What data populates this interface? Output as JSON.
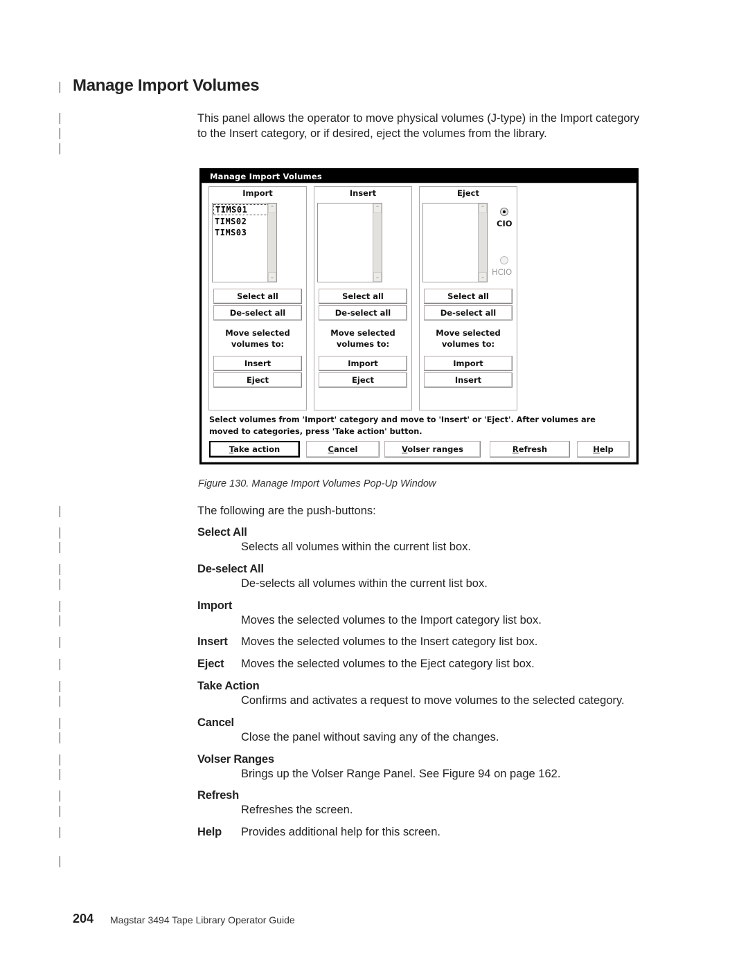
{
  "page": {
    "title": "Manage Import Volumes",
    "intro": "This panel allows the operator to move physical volumes (J-type) in the Import category to the Insert category, or if desired, eject the volumes from the library."
  },
  "window": {
    "title": "Manage Import Volumes",
    "groups": [
      {
        "title": "Import",
        "items": [
          "TIMS01",
          "TIMS02",
          "TIMS03"
        ],
        "select_all": "Select all",
        "deselect_all": "De-select all",
        "move_label_1": "Move selected",
        "move_label_2": "volumes to:",
        "move_buttons": [
          "Insert",
          "Eject"
        ]
      },
      {
        "title": "Insert",
        "items": [],
        "select_all": "Select all",
        "deselect_all": "De-select all",
        "move_label_1": "Move selected",
        "move_label_2": "volumes to:",
        "move_buttons": [
          "Import",
          "Eject"
        ]
      },
      {
        "title": "Eject",
        "items": [],
        "select_all": "Select all",
        "deselect_all": "De-select all",
        "move_label_1": "Move selected",
        "move_label_2": "volumes to:",
        "move_buttons": [
          "Import",
          "Insert"
        ],
        "radios": [
          {
            "label": "CIO",
            "selected": true,
            "enabled": true
          },
          {
            "label": "HCIO",
            "selected": false,
            "enabled": false
          }
        ]
      }
    ],
    "hint_line_1": "Select volumes from 'Import' category and move to 'Insert' or 'Eject'.  After volumes are",
    "hint_line_2": "moved to categories, press 'Take action' button.",
    "buttons": {
      "take_action": {
        "mnemonic": "T",
        "rest": "ake action"
      },
      "cancel": {
        "mnemonic": "C",
        "rest": "ancel"
      },
      "volser_ranges": {
        "mnemonic": "V",
        "rest": "olser ranges"
      },
      "refresh": {
        "mnemonic": "R",
        "rest": "efresh"
      },
      "help": {
        "mnemonic": "H",
        "rest": "elp"
      }
    }
  },
  "caption": "Figure 130. Manage Import Volumes Pop-Up Window",
  "lead": "The following are the push-buttons:",
  "definitions": [
    {
      "term": "Select All",
      "desc": "Selects all volumes within the current list box."
    },
    {
      "term": "De-select All",
      "desc": "De-selects all volumes within the current list box."
    },
    {
      "term": "Import",
      "desc": "Moves the selected volumes to the Import category list box."
    },
    {
      "term": "Insert",
      "desc": "Moves the selected volumes to the Insert category list box."
    },
    {
      "term": "Eject",
      "desc": "Moves the selected volumes to the Eject category list box."
    },
    {
      "term": "Take Action",
      "desc": "Confirms and activates a request to move volumes to the selected category."
    },
    {
      "term": "Cancel",
      "desc": "Close the panel without saving any of the changes."
    },
    {
      "term": "Volser Ranges",
      "desc": "Brings up the Volser Range Panel. See Figure 94 on page 162."
    },
    {
      "term": "Refresh",
      "desc": "Refreshes the screen."
    },
    {
      "term": "Help",
      "desc": "Provides additional help for this screen."
    }
  ],
  "footer": {
    "page_number": "204",
    "book_title": "Magstar 3494 Tape Library Operator Guide"
  }
}
